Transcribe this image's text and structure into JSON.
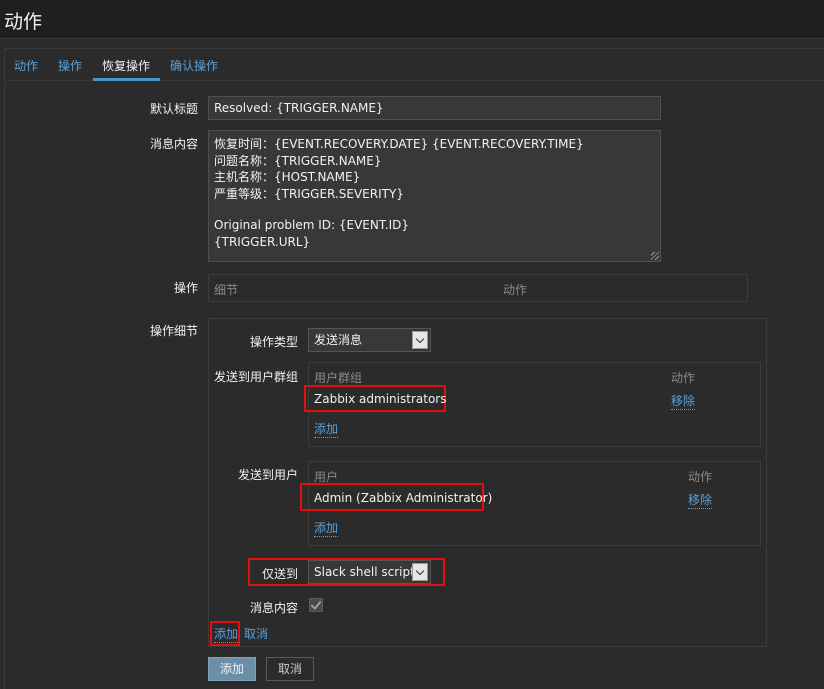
{
  "page": {
    "title": "动作"
  },
  "tabs": [
    {
      "label": "动作"
    },
    {
      "label": "操作"
    },
    {
      "label": "恢复操作",
      "active": true
    },
    {
      "label": "确认操作"
    }
  ],
  "form": {
    "default_subject_label": "默认标题",
    "default_subject_value": "Resolved: {TRIGGER.NAME}",
    "message_label": "消息内容",
    "message_lines": [
      "恢复时间：{EVENT.RECOVERY.DATE} {EVENT.RECOVERY.TIME}",
      "问题名称：{TRIGGER.NAME}",
      "主机名称：{HOST.NAME}",
      "严重等级：{TRIGGER.SEVERITY}",
      "",
      "Original problem ID: {EVENT.ID}",
      "{TRIGGER.URL}"
    ],
    "operations_label": "操作",
    "operations_col_details": "细节",
    "operations_col_action": "动作",
    "operation_details_label": "操作细节"
  },
  "operation_details": {
    "operation_type_label": "操作类型",
    "operation_type_value": "发送消息",
    "send_to_groups_label": "发送到用户群组",
    "groups_col_group": "用户群组",
    "groups_col_action": "动作",
    "groups": [
      {
        "name": "Zabbix administrators",
        "remove_label": "移除"
      }
    ],
    "groups_add_label": "添加",
    "send_to_users_label": "发送到用户",
    "users_col_user": "用户",
    "users_col_action": "动作",
    "users": [
      {
        "name": "Admin (Zabbix Administrator)",
        "remove_label": "移除"
      }
    ],
    "users_add_label": "添加",
    "send_only_to_label": "仅送到",
    "send_only_to_value": "Slack shell script",
    "message_content_label": "消息内容",
    "message_content_checked": true,
    "add_link": "添加",
    "cancel_link": "取消"
  },
  "footer": {
    "add_button": "添加",
    "cancel_button": "取消"
  },
  "colors": {
    "accent": "#5aa0d8",
    "highlight": "#e01010",
    "primary_button": "#6c8fa8"
  }
}
